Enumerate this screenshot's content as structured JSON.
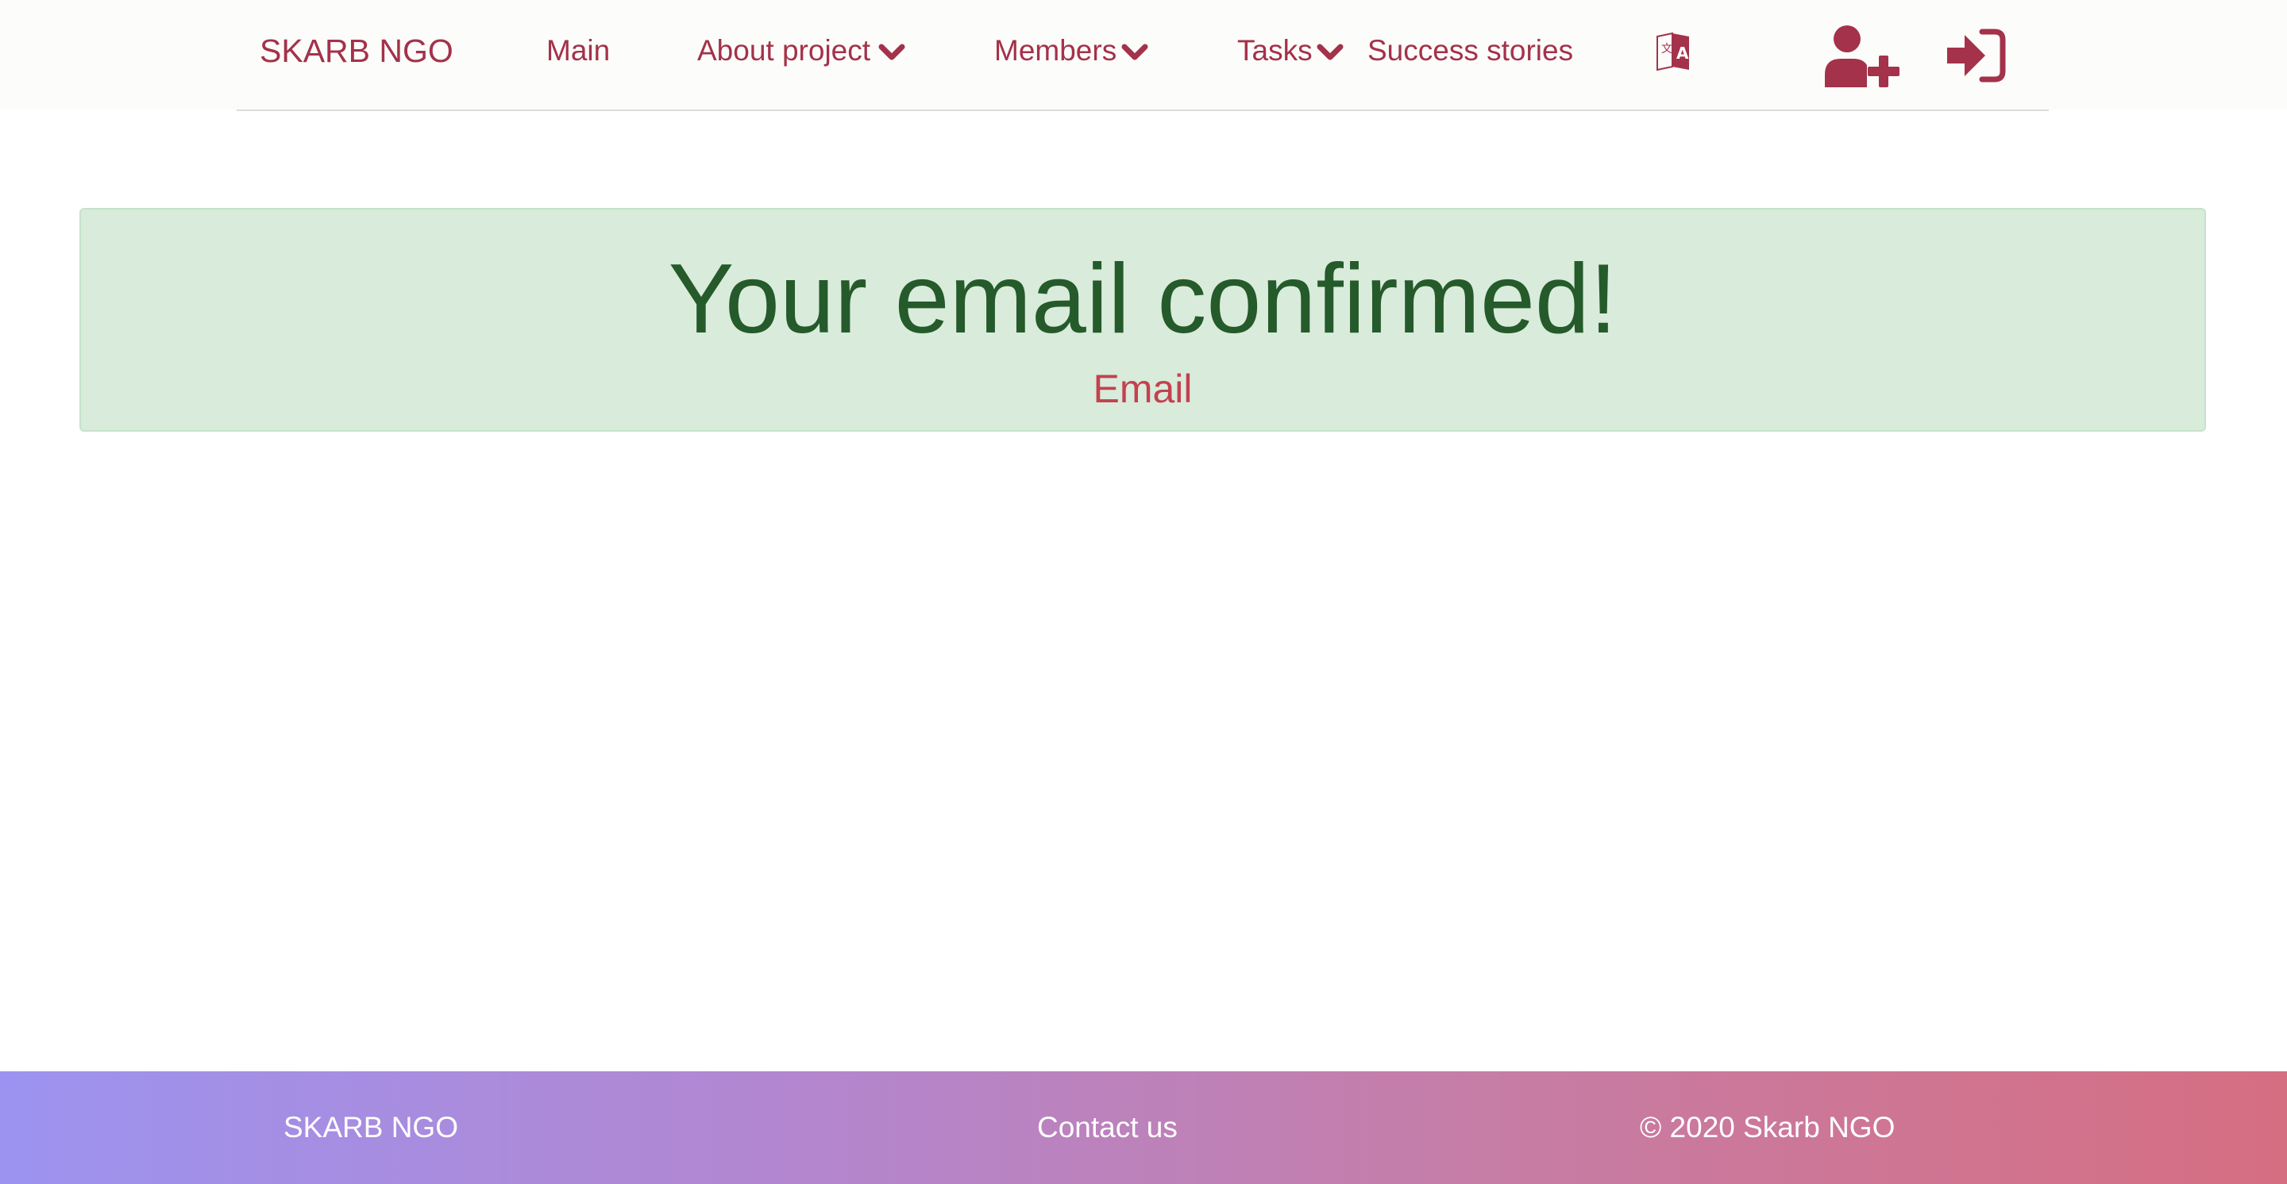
{
  "header": {
    "brand": "SKARB NGO",
    "nav": {
      "main": "Main",
      "about_project": "About project",
      "members": "Members",
      "tasks": "Tasks",
      "success_stories": "Success stories"
    },
    "icons": {
      "language": "language-translate-icon",
      "register": "user-plus-icon",
      "login": "sign-in-icon",
      "dropdown": "chevron-down-icon"
    }
  },
  "alert": {
    "title": "Your email confirmed!",
    "subtitle": "Email"
  },
  "footer": {
    "brand": "SKARB NGO",
    "contact": "Contact us",
    "copyright": "© 2020 Skarb NGO"
  },
  "colors": {
    "accent": "#a3324a",
    "alert_bg": "#d9ebdb",
    "alert_text": "#255a2b",
    "alert_subtitle": "#c2424e",
    "footer_gradient_start": "#9c93f0",
    "footer_gradient_end": "#d66e82"
  }
}
